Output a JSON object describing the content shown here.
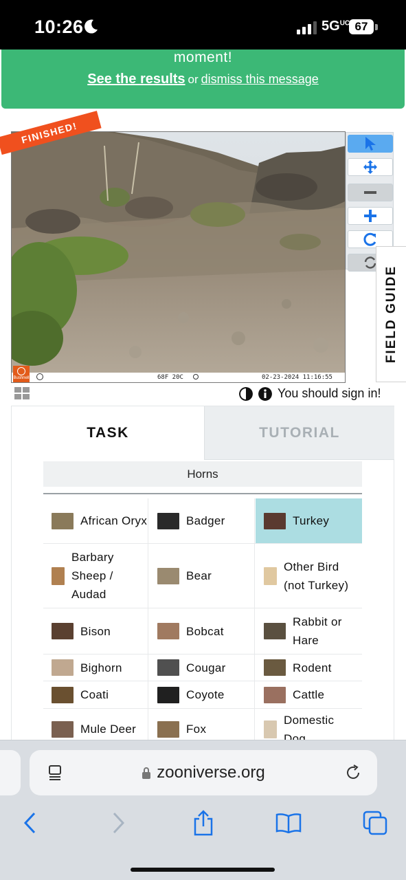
{
  "status_bar": {
    "time": "10:26",
    "network": "5G",
    "network_suffix": "UC",
    "battery": "67"
  },
  "banner": {
    "line1": "moment!",
    "results_link": "See the results",
    "or_text": "or",
    "dismiss_link": "dismiss this message"
  },
  "viewer": {
    "badge": "FINISHED!",
    "camera_temp": "68F 20C",
    "camera_datetime": "02-23-2024  11:16:55",
    "camera_brand": "Bushnell"
  },
  "toolbar": {
    "icons": [
      "pointer-icon",
      "move-icon",
      "zoom-out-icon",
      "zoom-in-icon",
      "reset-icon",
      "rotate-icon"
    ]
  },
  "field_guide": "FIELD GUIDE",
  "sign_in": "You should sign in!",
  "tabs": {
    "task": "TASK",
    "tutorial": "TUTORIAL"
  },
  "filter": "Horns",
  "choices": [
    [
      {
        "label": "African Oryx",
        "color": "#8a7a5a"
      },
      {
        "label": "Badger",
        "color": "#2a2a2a"
      },
      {
        "label": "Turkey",
        "color": "#5a3a30",
        "selected": true
      }
    ],
    [
      {
        "label": "Barbary Sheep / Audad",
        "color": "#b08050"
      },
      {
        "label": "Bear",
        "color": "#9a8a70"
      },
      {
        "label": "Other Bird (not Turkey)",
        "color": "#e0c8a0"
      }
    ],
    [
      {
        "label": "Bison",
        "color": "#5a4030"
      },
      {
        "label": "Bobcat",
        "color": "#a07a60"
      },
      {
        "label": "Rabbit or Hare",
        "color": "#5a5040"
      }
    ],
    [
      {
        "label": "Bighorn",
        "color": "#c0a890"
      },
      {
        "label": "Cougar",
        "color": "#505050"
      },
      {
        "label": "Rodent",
        "color": "#6a5a40"
      }
    ],
    [
      {
        "label": "Coati",
        "color": "#6a5030"
      },
      {
        "label": "Coyote",
        "color": "#202020"
      },
      {
        "label": "Cattle",
        "color": "#9a7060"
      }
    ],
    [
      {
        "label": "Mule Deer",
        "color": "#7a6050"
      },
      {
        "label": "Fox",
        "color": "#8a7050"
      },
      {
        "label": "Domestic Dog",
        "color": "#d8c8b0"
      }
    ]
  ],
  "browser": {
    "url": "zooniverse.org"
  },
  "colors": {
    "banner": "#3cb876",
    "selected": "#acdde2",
    "active_tool": "#5aaaf0",
    "finished_badge": "#f0501e"
  }
}
